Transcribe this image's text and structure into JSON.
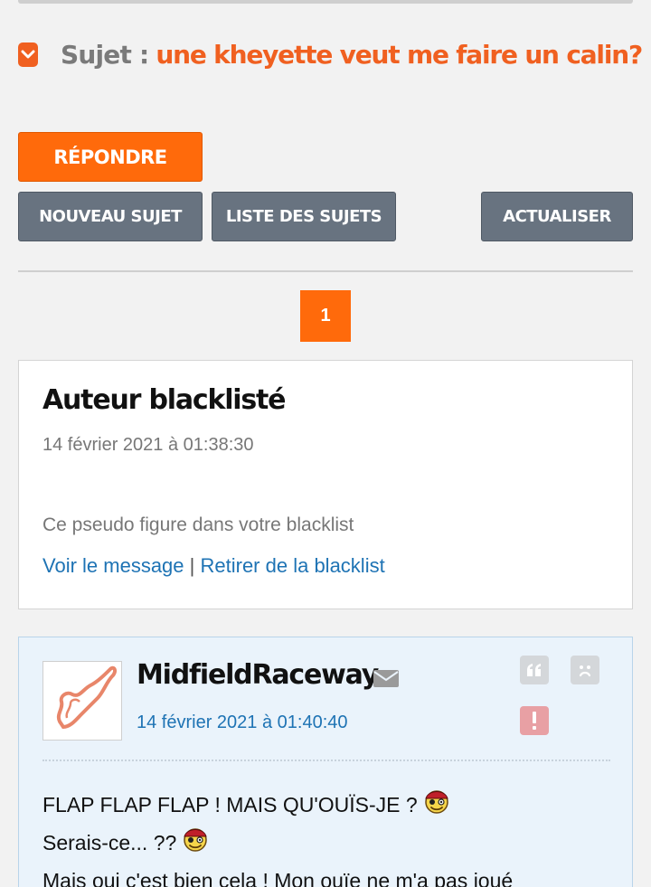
{
  "topic": {
    "prefix": "Sujet :",
    "title": "une kheyette veut me faire un calin?"
  },
  "actions": {
    "reply": "RÉPONDRE",
    "new_topic": "NOUVEAU SUJET",
    "topic_list": "LISTE DES SUJETS",
    "refresh": "ACTUALISER"
  },
  "pagination": {
    "current_page": "1"
  },
  "blacklisted_post": {
    "author": "Auteur blacklisté",
    "date": "14 février 2021 à 01:38:30",
    "note": "Ce pseudo figure dans votre blacklist",
    "view_link": "Voir le message",
    "separator": "|",
    "remove_link": "Retirer de la blacklist"
  },
  "post": {
    "author": "MidfieldRaceway",
    "date": "14 février 2021 à 01:40:40",
    "lines": [
      "FLAP FLAP FLAP ! MAIS QU'OUÏS-JE ?",
      "Serais-ce... ??",
      "Mais oui c'est bien cela ! Mon ouïe ne m'a pas joué"
    ]
  },
  "colors": {
    "accent": "#ff6a0b",
    "topic_title": "#f06020",
    "secondary_button": "#687380",
    "link": "#1e73b4",
    "post_background": "#eaf3fb",
    "report_icon": "#e8a0a4"
  },
  "icons": {
    "topic_toggle": "chevron-down-icon",
    "mail": "envelope-icon",
    "quote": "quote-icon",
    "blacklist": "sad-face-icon",
    "report": "exclamation-icon",
    "smiley": "pirate-smiley-icon"
  }
}
